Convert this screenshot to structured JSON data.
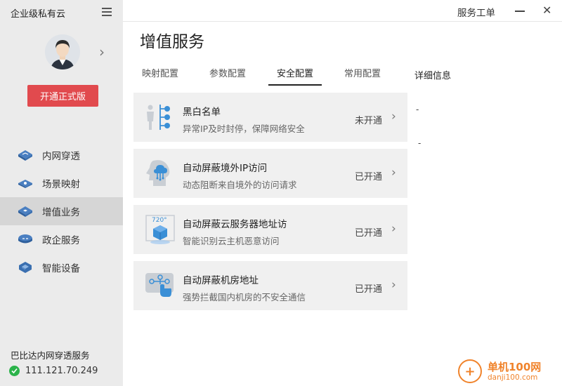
{
  "app": {
    "title": "企业级私有云",
    "upgrade_label": "开通正式版"
  },
  "titlebar": {
    "work_order": "服务工单",
    "minimize_icon": "minimize-icon",
    "close_symbol": "✕"
  },
  "sidebar": {
    "items": [
      {
        "label": "内网穿透",
        "icon": "network-penetration-icon",
        "active": false
      },
      {
        "label": "场景映射",
        "icon": "scene-mapping-icon",
        "active": false
      },
      {
        "label": "增值业务",
        "icon": "value-added-icon",
        "active": true
      },
      {
        "label": "政企服务",
        "icon": "government-service-icon",
        "active": false
      },
      {
        "label": "智能设备",
        "icon": "smart-device-icon",
        "active": false
      }
    ],
    "footer": {
      "service_label": "巴比达内网穿透服务",
      "ip": "111.121.70.249"
    }
  },
  "main": {
    "page_title": "增值服务",
    "tabs": [
      {
        "label": "映射配置",
        "active": false
      },
      {
        "label": "参数配置",
        "active": false
      },
      {
        "label": "安全配置",
        "active": true
      },
      {
        "label": "常用配置",
        "active": false
      }
    ],
    "detail_title": "详细信息",
    "detail_values": [
      "-",
      "-"
    ],
    "cards": [
      {
        "title": "黑白名单",
        "desc": "异常IP及时封停，保障网络安全",
        "status": "未开通",
        "icon": "blacklist-icon"
      },
      {
        "title": "自动屏蔽境外IP访问",
        "desc": "动态阻断来自境外的访问请求",
        "status": "已开通",
        "icon": "foreign-ip-block-icon"
      },
      {
        "title": "自动屏蔽云服务器地址访",
        "desc": "智能识别云主机恶意访问",
        "status": "已开通",
        "icon": "cloud-server-block-icon",
        "badge": "720°"
      },
      {
        "title": "自动屏蔽机房地址",
        "desc": "强势拦截国内机房的不安全通信",
        "status": "已开通",
        "icon": "datacenter-block-icon"
      }
    ]
  },
  "watermark": {
    "name": "单机100网",
    "domain": "danji100.com"
  },
  "colors": {
    "accent_red": "#e14a4e",
    "active_nav_bg": "#d6d6d6",
    "sidebar_bg": "#ebebeb",
    "icon_blue": "#3a8fd6",
    "ok_green": "#2bb34a"
  }
}
